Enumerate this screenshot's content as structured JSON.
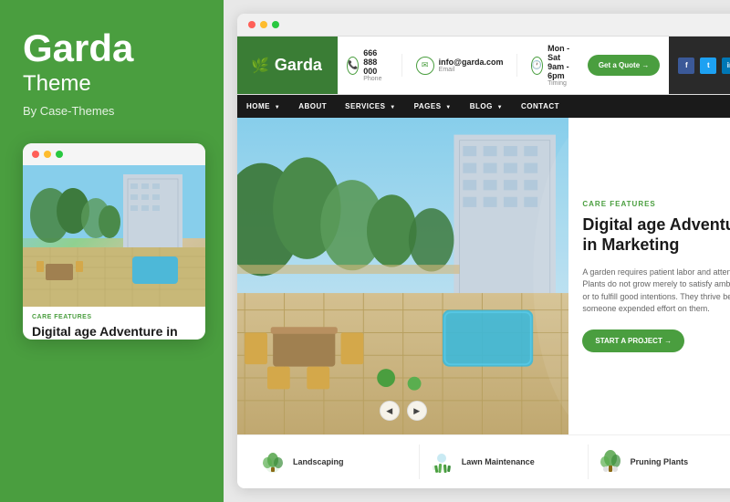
{
  "left": {
    "title": "Garda",
    "subtitle": "Theme",
    "author": "By Case-Themes",
    "mini_browser": {
      "dots": [
        "red",
        "yellow",
        "green"
      ],
      "care_label": "CARE FEATURES",
      "card_title": "Digital age Adventure in"
    }
  },
  "right": {
    "browser_dots": [
      "red",
      "yellow",
      "green"
    ],
    "site": {
      "logo": "Garda",
      "logo_icon": "🌿",
      "contacts": [
        {
          "icon": "📞",
          "main": "666 888 000",
          "sub": "Phone"
        },
        {
          "icon": "✉",
          "main": "info@garda.com",
          "sub": "Email"
        },
        {
          "icon": "🕐",
          "main": "Mon - Sat 9am - 6pm",
          "sub": "Timing"
        }
      ],
      "quote_btn": "Get a Quote →",
      "social": [
        "f",
        "t",
        "in",
        "▶"
      ],
      "nav": [
        {
          "label": "HOME",
          "has_arrow": true
        },
        {
          "label": "ABOUT",
          "has_arrow": false
        },
        {
          "label": "SERVICES",
          "has_arrow": true
        },
        {
          "label": "PAGES",
          "has_arrow": true
        },
        {
          "label": "BLOG",
          "has_arrow": true
        },
        {
          "label": "CONTACT",
          "has_arrow": false
        }
      ],
      "hero": {
        "care_label": "CARE FEATURES",
        "title": "Digital age Adventure in Marketing",
        "description": "A garden requires patient labor and attention. Plants do not grow merely to satisfy ambitions or to fulfill good intentions. They thrive because someone expended effort on them.",
        "start_btn": "START A PROJECT →"
      },
      "services": [
        {
          "icon": "🌿",
          "name": "Landscaping"
        },
        {
          "icon": "🌱",
          "name": "Lawn Maintenance"
        },
        {
          "icon": "🪴",
          "name": "Pruning Plants"
        }
      ]
    }
  }
}
